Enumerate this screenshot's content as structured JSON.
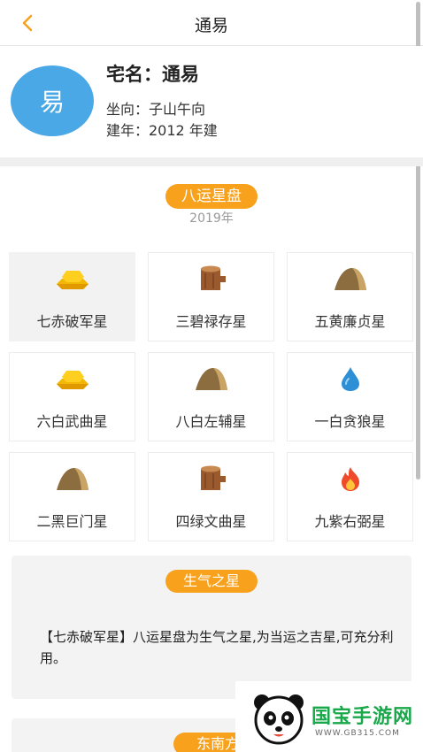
{
  "nav": {
    "title": "通易",
    "back_icon": "chevron-left-icon"
  },
  "house": {
    "avatar_text": "易",
    "name": "宅名：通易",
    "direction": "坐向：子山午向",
    "year": "建年：2012 年建"
  },
  "chart": {
    "title": "八运星盘",
    "year": "2019年"
  },
  "stars": [
    {
      "label": "七赤破军星",
      "icon": "gold-bars-icon",
      "selected": true
    },
    {
      "label": "三碧禄存星",
      "icon": "wood-stump-icon"
    },
    {
      "label": "五黄廉贞星",
      "icon": "earth-mound-icon"
    },
    {
      "label": "六白武曲星",
      "icon": "gold-bars-icon"
    },
    {
      "label": "八白左辅星",
      "icon": "earth-mound-icon"
    },
    {
      "label": "一白贪狼星",
      "icon": "water-drop-icon"
    },
    {
      "label": "二黑巨门星",
      "icon": "earth-mound-icon"
    },
    {
      "label": "四绿文曲星",
      "icon": "wood-stump-icon"
    },
    {
      "label": "九紫右弼星",
      "icon": "fire-icon"
    }
  ],
  "detail": {
    "title": "生气之星",
    "text": "【七赤破军星】八运星盘为生气之星,为当运之吉星,可充分利用。"
  },
  "next_section": {
    "title": "东南方"
  },
  "watermark": {
    "logo": "国宝手游网",
    "url": "WWW.GB315.COM"
  },
  "colors": {
    "accent": "#f7a11c",
    "avatar": "#4aa8e6",
    "watermark_green": "#19a84a"
  }
}
